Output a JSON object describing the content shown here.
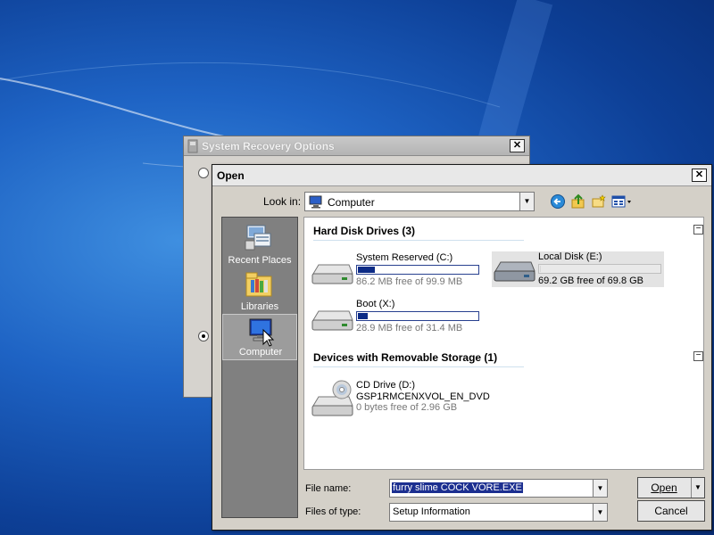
{
  "background": {
    "colors": {
      "base": "#1e63c4",
      "dark": "#082c74",
      "light": "#3f8fe0"
    }
  },
  "recovery_window": {
    "title": "System Recovery Options",
    "close_glyph": "✕",
    "radio_top_checked": false,
    "radio_bottom_checked": true
  },
  "open_dialog": {
    "title": "Open",
    "close_glyph": "✕",
    "look_in": {
      "label": "Look in:",
      "value": "Computer",
      "icon": "computer-icon"
    },
    "toolbar": [
      {
        "name": "back-button",
        "icon": "back-arrow-icon"
      },
      {
        "name": "up-folder-button",
        "icon": "up-folder-icon"
      },
      {
        "name": "new-folder-button",
        "icon": "new-folder-icon"
      },
      {
        "name": "view-menu-button",
        "icon": "view-menu-icon"
      }
    ],
    "places": [
      {
        "label": "Recent Places",
        "icon": "recent-places-icon",
        "selected": false
      },
      {
        "label": "Libraries",
        "icon": "libraries-icon",
        "selected": false
      },
      {
        "label": "Computer",
        "icon": "computer-icon",
        "selected": true
      }
    ],
    "groups": [
      {
        "title": "Hard Disk Drives (3)",
        "collapse_glyph": "−",
        "drives": [
          {
            "name": "System Reserved (C:)",
            "free_text": "86.2 MB free of 99.9 MB",
            "used_fraction": 0.137,
            "selected": false
          },
          {
            "name": "Local Disk (E:)",
            "free_text": "69.2 GB free of 69.8 GB",
            "used_fraction": 0.009,
            "selected": true
          },
          {
            "name": "Boot (X:)",
            "free_text": "28.9 MB free of 31.4 MB",
            "used_fraction": 0.08,
            "selected": false
          }
        ]
      },
      {
        "title": "Devices with Removable Storage (1)",
        "collapse_glyph": "−",
        "drives": [
          {
            "name": "CD Drive (D:)",
            "label": "GSP1RMCENXVOL_EN_DVD",
            "free_text": "0 bytes free of 2.96 GB"
          }
        ]
      }
    ],
    "file_name": {
      "label": "File name:",
      "value": "furry slime COCK VORE.EXE"
    },
    "file_type": {
      "label": "Files of type:",
      "value": "Setup Information"
    },
    "buttons": {
      "open": "Open",
      "cancel": "Cancel"
    },
    "dropdown_glyph": "▼"
  },
  "colors": {
    "selection": "#1c2f90",
    "bar_fill": "#0c2b86",
    "places_bg": "#808080"
  }
}
